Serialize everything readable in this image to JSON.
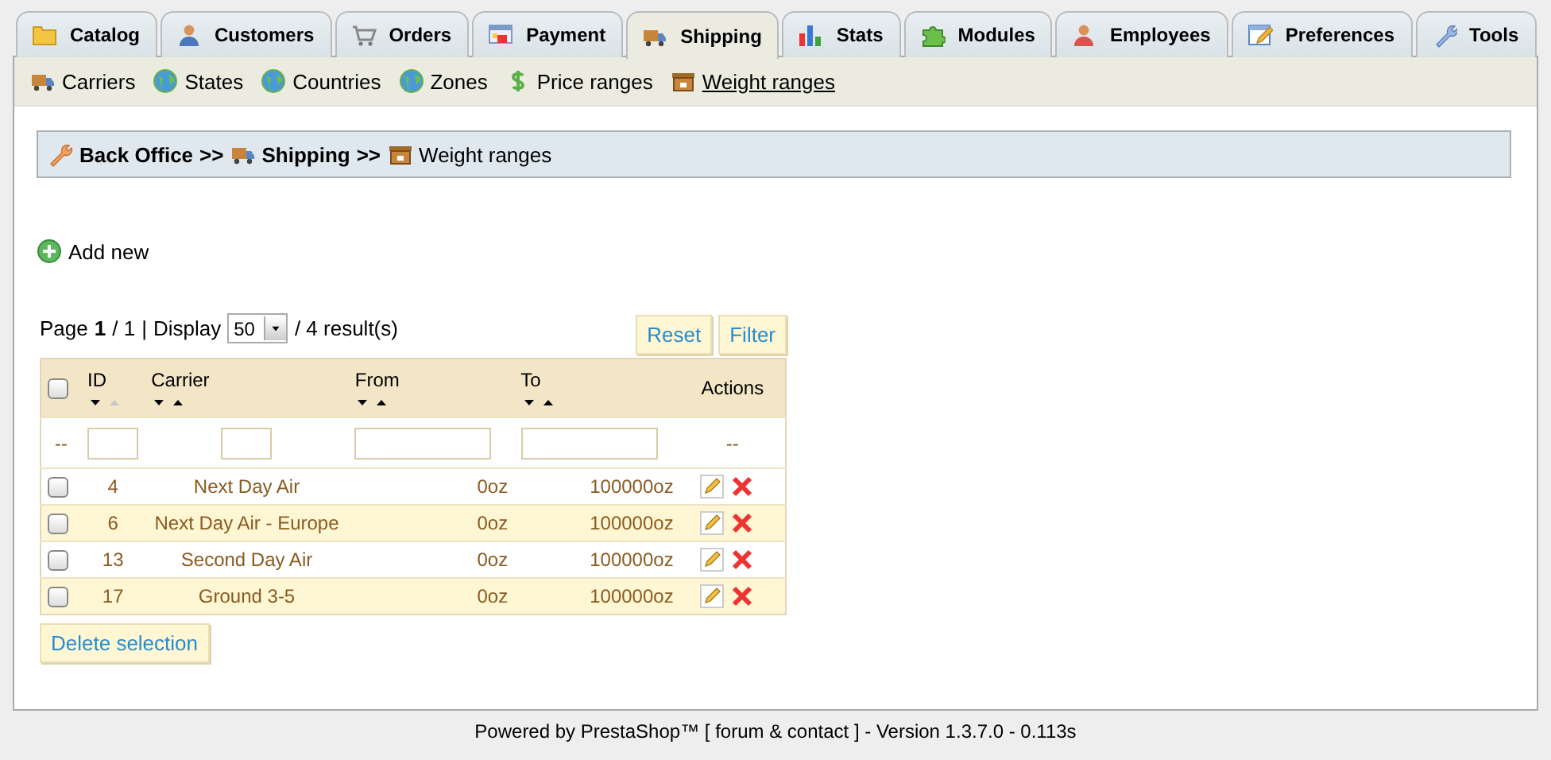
{
  "tabs": [
    {
      "label": "Catalog",
      "selected": false
    },
    {
      "label": "Customers",
      "selected": false
    },
    {
      "label": "Orders",
      "selected": false
    },
    {
      "label": "Payment",
      "selected": false
    },
    {
      "label": "Shipping",
      "selected": true
    },
    {
      "label": "Stats",
      "selected": false
    },
    {
      "label": "Modules",
      "selected": false
    },
    {
      "label": "Employees",
      "selected": false
    },
    {
      "label": "Preferences",
      "selected": false
    },
    {
      "label": "Tools",
      "selected": false
    }
  ],
  "subtabs": [
    {
      "label": "Carriers",
      "selected": false
    },
    {
      "label": "States",
      "selected": false
    },
    {
      "label": "Countries",
      "selected": false
    },
    {
      "label": "Zones",
      "selected": false
    },
    {
      "label": "Price ranges",
      "selected": false
    },
    {
      "label": "Weight ranges",
      "selected": true
    }
  ],
  "breadcrumb": [
    {
      "kind": "link",
      "label": "Back Office"
    },
    {
      "kind": "separator",
      "label": ">>"
    },
    {
      "kind": "link",
      "label": "Shipping"
    },
    {
      "kind": "separator",
      "label": ">>"
    },
    {
      "kind": "current",
      "label": "Weight ranges"
    }
  ],
  "add_new": "Add new",
  "pagination": {
    "page_label": "Page",
    "page": "1",
    "total": "/ 1",
    "divider": "|",
    "display_label": "Display",
    "per_page": "50",
    "results": "/ 4 result(s)"
  },
  "filter_buttons": [
    "Reset",
    "Filter"
  ],
  "table": {
    "select_all_checked": false,
    "columns": [
      {
        "label": "ID",
        "sortable": true,
        "up_dimmed": true
      },
      {
        "label": "Carrier",
        "sortable": true,
        "up_dimmed": false
      },
      {
        "label": "From",
        "sortable": true,
        "up_dimmed": false
      },
      {
        "label": "To",
        "sortable": true,
        "up_dimmed": false
      },
      {
        "label": "Actions",
        "sortable": false
      }
    ],
    "filters": [
      {
        "kind": "text",
        "text": "--"
      },
      {
        "kind": "input"
      },
      {
        "kind": "input"
      },
      {
        "kind": "input"
      },
      {
        "kind": "input"
      },
      {
        "kind": "text",
        "text": "--"
      }
    ],
    "rows": [
      {
        "id": "4",
        "carrier": "Next Day Air",
        "from": "0oz",
        "to": "100000oz",
        "checked": false
      },
      {
        "id": "6",
        "carrier": "Next Day Air - Europe",
        "from": "0oz",
        "to": "100000oz",
        "checked": false
      },
      {
        "id": "13",
        "carrier": "Second Day Air",
        "from": "0oz",
        "to": "100000oz",
        "checked": false
      },
      {
        "id": "17",
        "carrier": "Ground 3-5",
        "from": "0oz",
        "to": "100000oz",
        "checked": false
      }
    ]
  },
  "delete_button": "Delete selection",
  "footer": "Powered by PrestaShop™ [ forum & contact ] - Version 1.3.7.0 - 0.113s"
}
